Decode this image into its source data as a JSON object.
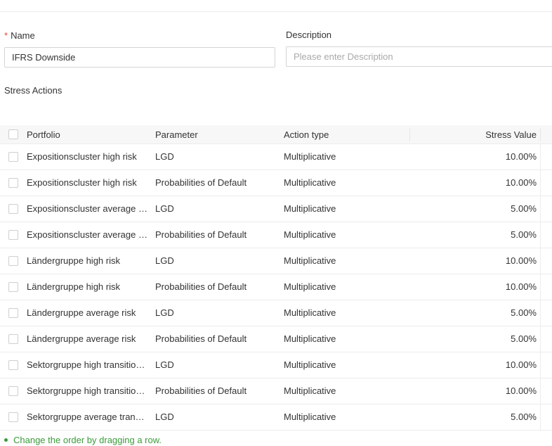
{
  "form": {
    "name_label": "Name",
    "name_required_mark": "*",
    "name_value": "IFRS Downside",
    "description_label": "Description",
    "description_placeholder": "Please enter Description",
    "description_value": ""
  },
  "stress_actions": {
    "title": "Stress Actions",
    "columns": {
      "portfolio": "Portfolio",
      "parameter": "Parameter",
      "action_type": "Action type",
      "stress_value": "Stress Value"
    },
    "rows": [
      {
        "portfolio": "Expositionscluster high risk",
        "parameter": "LGD",
        "action_type": "Multiplicative",
        "stress_value": "10.00%"
      },
      {
        "portfolio": "Expositionscluster high risk",
        "parameter": "Probabilities of Default",
        "action_type": "Multiplicative",
        "stress_value": "10.00%"
      },
      {
        "portfolio": "Expositionscluster average risk",
        "parameter": "LGD",
        "action_type": "Multiplicative",
        "stress_value": "5.00%"
      },
      {
        "portfolio": "Expositionscluster average risk",
        "parameter": "Probabilities of Default",
        "action_type": "Multiplicative",
        "stress_value": "5.00%"
      },
      {
        "portfolio": "Ländergruppe high risk",
        "parameter": "LGD",
        "action_type": "Multiplicative",
        "stress_value": "10.00%"
      },
      {
        "portfolio": "Ländergruppe high risk",
        "parameter": "Probabilities of Default",
        "action_type": "Multiplicative",
        "stress_value": "10.00%"
      },
      {
        "portfolio": "Ländergruppe average risk",
        "parameter": "LGD",
        "action_type": "Multiplicative",
        "stress_value": "5.00%"
      },
      {
        "portfolio": "Ländergruppe average risk",
        "parameter": "Probabilities of Default",
        "action_type": "Multiplicative",
        "stress_value": "5.00%"
      },
      {
        "portfolio": "Sektorgruppe high transition ...",
        "parameter": "LGD",
        "action_type": "Multiplicative",
        "stress_value": "10.00%"
      },
      {
        "portfolio": "Sektorgruppe high transition ...",
        "parameter": "Probabilities of Default",
        "action_type": "Multiplicative",
        "stress_value": "10.00%"
      },
      {
        "portfolio": "Sektorgruppe average transiti...",
        "parameter": "LGD",
        "action_type": "Multiplicative",
        "stress_value": "5.00%"
      }
    ],
    "hint": "Change the order by dragging a row."
  },
  "colors": {
    "required": "#e8483a",
    "hint": "#3a9b3a",
    "header_bg": "#f7f7f7",
    "border": "#d4d4d4"
  }
}
